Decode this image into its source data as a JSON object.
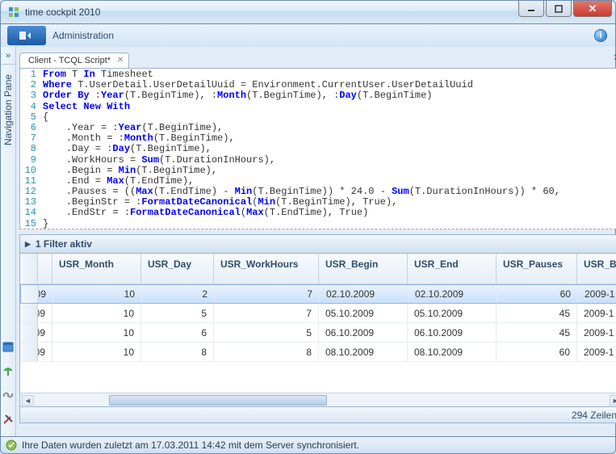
{
  "window": {
    "title": "time cockpit 2010"
  },
  "ribbon": {
    "label": "Administration"
  },
  "sidebar": {
    "label": "Navigation Pane"
  },
  "tab": {
    "label": "Client - TCQL Script*"
  },
  "code": {
    "lines": [
      {
        "n": 1,
        "segs": [
          [
            "kw",
            "From"
          ],
          [
            "",
            " T "
          ],
          [
            "kw",
            "In"
          ],
          [
            "",
            " Timesheet"
          ]
        ]
      },
      {
        "n": 2,
        "segs": [
          [
            "kw",
            "Where"
          ],
          [
            "",
            " T.UserDetail.UserDetailUuid = Environment.CurrentUser.UserDetailUuid"
          ]
        ]
      },
      {
        "n": 3,
        "segs": [
          [
            "kw",
            "Order By"
          ],
          [
            "",
            " :"
          ],
          [
            "fn",
            "Year"
          ],
          [
            "",
            "(T.BeginTime), :"
          ],
          [
            "fn",
            "Month"
          ],
          [
            "",
            "(T.BeginTime), :"
          ],
          [
            "fn",
            "Day"
          ],
          [
            "",
            "(T.BeginTime)"
          ]
        ]
      },
      {
        "n": 4,
        "segs": [
          [
            "kw",
            "Select New With"
          ]
        ]
      },
      {
        "n": 5,
        "segs": [
          [
            "",
            "{"
          ]
        ]
      },
      {
        "n": 6,
        "segs": [
          [
            "",
            "    .Year = :"
          ],
          [
            "fn",
            "Year"
          ],
          [
            "",
            "(T.BeginTime),"
          ]
        ]
      },
      {
        "n": 7,
        "segs": [
          [
            "",
            "    .Month = :"
          ],
          [
            "fn",
            "Month"
          ],
          [
            "",
            "(T.BeginTime),"
          ]
        ]
      },
      {
        "n": 8,
        "segs": [
          [
            "",
            "    .Day = :"
          ],
          [
            "fn",
            "Day"
          ],
          [
            "",
            "(T.BeginTime),"
          ]
        ]
      },
      {
        "n": 9,
        "segs": [
          [
            "",
            "    .WorkHours = "
          ],
          [
            "fn",
            "Sum"
          ],
          [
            "",
            "(T.DurationInHours),"
          ]
        ]
      },
      {
        "n": 10,
        "segs": [
          [
            "",
            "    .Begin = "
          ],
          [
            "fn",
            "Min"
          ],
          [
            "",
            "(T.BeginTime),"
          ]
        ]
      },
      {
        "n": 11,
        "segs": [
          [
            "",
            "    .End = "
          ],
          [
            "fn",
            "Max"
          ],
          [
            "",
            "(T.EndTime),"
          ]
        ]
      },
      {
        "n": 12,
        "segs": [
          [
            "",
            "    .Pauses = (("
          ],
          [
            "fn",
            "Max"
          ],
          [
            "",
            "(T.EndTime) - "
          ],
          [
            "fn",
            "Min"
          ],
          [
            "",
            "(T.BeginTime)) * 24.0 - "
          ],
          [
            "fn",
            "Sum"
          ],
          [
            "",
            "(T.DurationInHours)) * 60,"
          ]
        ]
      },
      {
        "n": 13,
        "segs": [
          [
            "",
            "    .BeginStr = :"
          ],
          [
            "fn",
            "FormatDateCanonical"
          ],
          [
            "",
            "("
          ],
          [
            "fn",
            "Min"
          ],
          [
            "",
            "(T.BeginTime), True),"
          ]
        ]
      },
      {
        "n": 14,
        "segs": [
          [
            "",
            "    .EndStr = :"
          ],
          [
            "fn",
            "FormatDateCanonical"
          ],
          [
            "",
            "("
          ],
          [
            "fn",
            "Max"
          ],
          [
            "",
            "(T.EndTime), True)"
          ]
        ]
      },
      {
        "n": 15,
        "segs": [
          [
            "",
            "}"
          ]
        ]
      }
    ]
  },
  "filter": {
    "label": "1 Filter aktiv"
  },
  "grid": {
    "columns": [
      "USR_Month",
      "USR_Day",
      "USR_WorkHours",
      "USR_Begin",
      "USR_End",
      "USR_Pauses",
      "USR_B"
    ],
    "rows": [
      {
        "yr": "09",
        "mon": "10",
        "day": "2",
        "wh": "7",
        "beg": "02.10.2009",
        "end": "02.10.2009",
        "pau": "60",
        "bs": "2009-1",
        "sel": true
      },
      {
        "yr": "09",
        "mon": "10",
        "day": "5",
        "wh": "7",
        "beg": "05.10.2009",
        "end": "05.10.2009",
        "pau": "45",
        "bs": "2009-1"
      },
      {
        "yr": "09",
        "mon": "10",
        "day": "6",
        "wh": "5",
        "beg": "06.10.2009",
        "end": "06.10.2009",
        "pau": "45",
        "bs": "2009-1"
      },
      {
        "yr": "09",
        "mon": "10",
        "day": "8",
        "wh": "8",
        "beg": "08.10.2009",
        "end": "08.10.2009",
        "pau": "60",
        "bs": "2009-1"
      }
    ],
    "footer": "294 Zeilen"
  },
  "status": {
    "text": "Ihre Daten wurden zuletzt am 17.03.2011 14:42 mit dem Server synchronisiert."
  }
}
